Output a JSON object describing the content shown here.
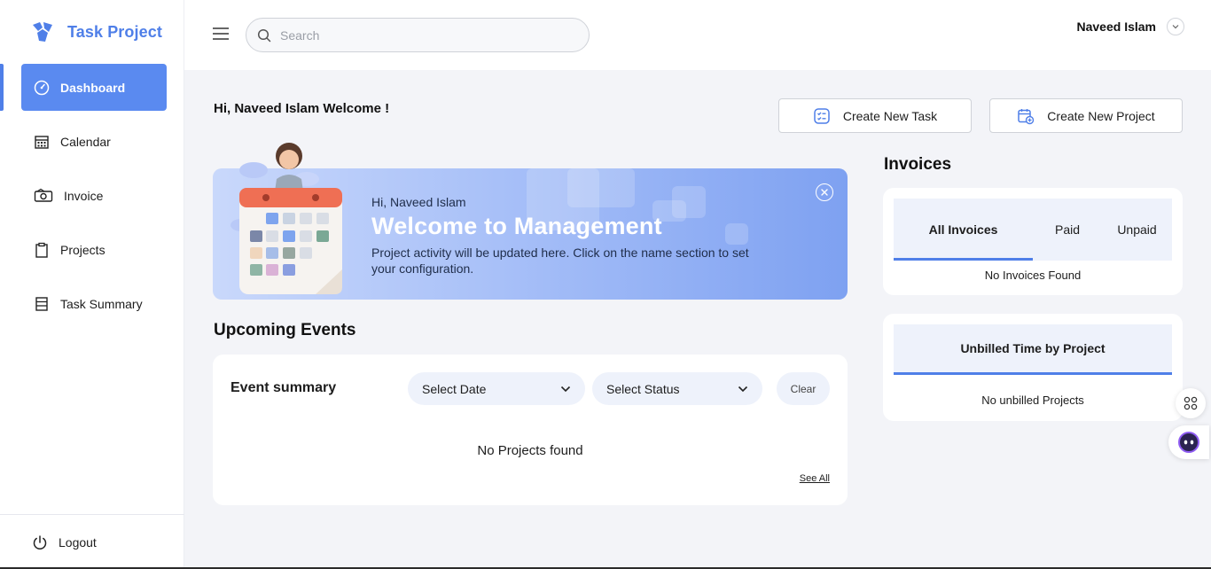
{
  "brand": {
    "name": "Task Project"
  },
  "sidebar": {
    "items": [
      {
        "label": "Dashboard",
        "icon": "dashboard-icon",
        "active": true
      },
      {
        "label": "Calendar",
        "icon": "calendar-icon"
      },
      {
        "label": "Invoice",
        "icon": "invoice-icon"
      },
      {
        "label": "Projects",
        "icon": "clipboard-icon"
      },
      {
        "label": "Task Summary",
        "icon": "list-icon"
      }
    ],
    "logout": "Logout"
  },
  "header": {
    "search_placeholder": "Search",
    "user_name": "Naveed Islam"
  },
  "main": {
    "welcome": "Hi, Naveed Islam Welcome !",
    "create_task": "Create New Task",
    "create_project": "Create New Project",
    "banner": {
      "greeting": "Hi, Naveed Islam",
      "title": "Welcome to Management",
      "description": "Project activity will be updated here. Click on the name section to set your configuration."
    },
    "upcoming": {
      "title": "Upcoming Events",
      "summary_label": "Event summary",
      "select_date": "Select Date",
      "select_status": "Select Status",
      "clear": "Clear",
      "empty": "No Projects found",
      "see_all": "See All"
    },
    "invoices": {
      "title": "Invoices",
      "tabs": [
        "All Invoices",
        "Paid",
        "Unpaid"
      ],
      "empty": "No Invoices Found"
    },
    "unbilled": {
      "title": "Unbilled Time by Project",
      "empty": "No unbilled Projects"
    }
  },
  "colors": {
    "accent": "#4f7fe8",
    "active_nav": "#5a8af0",
    "soft_bg": "#eef2fb"
  }
}
